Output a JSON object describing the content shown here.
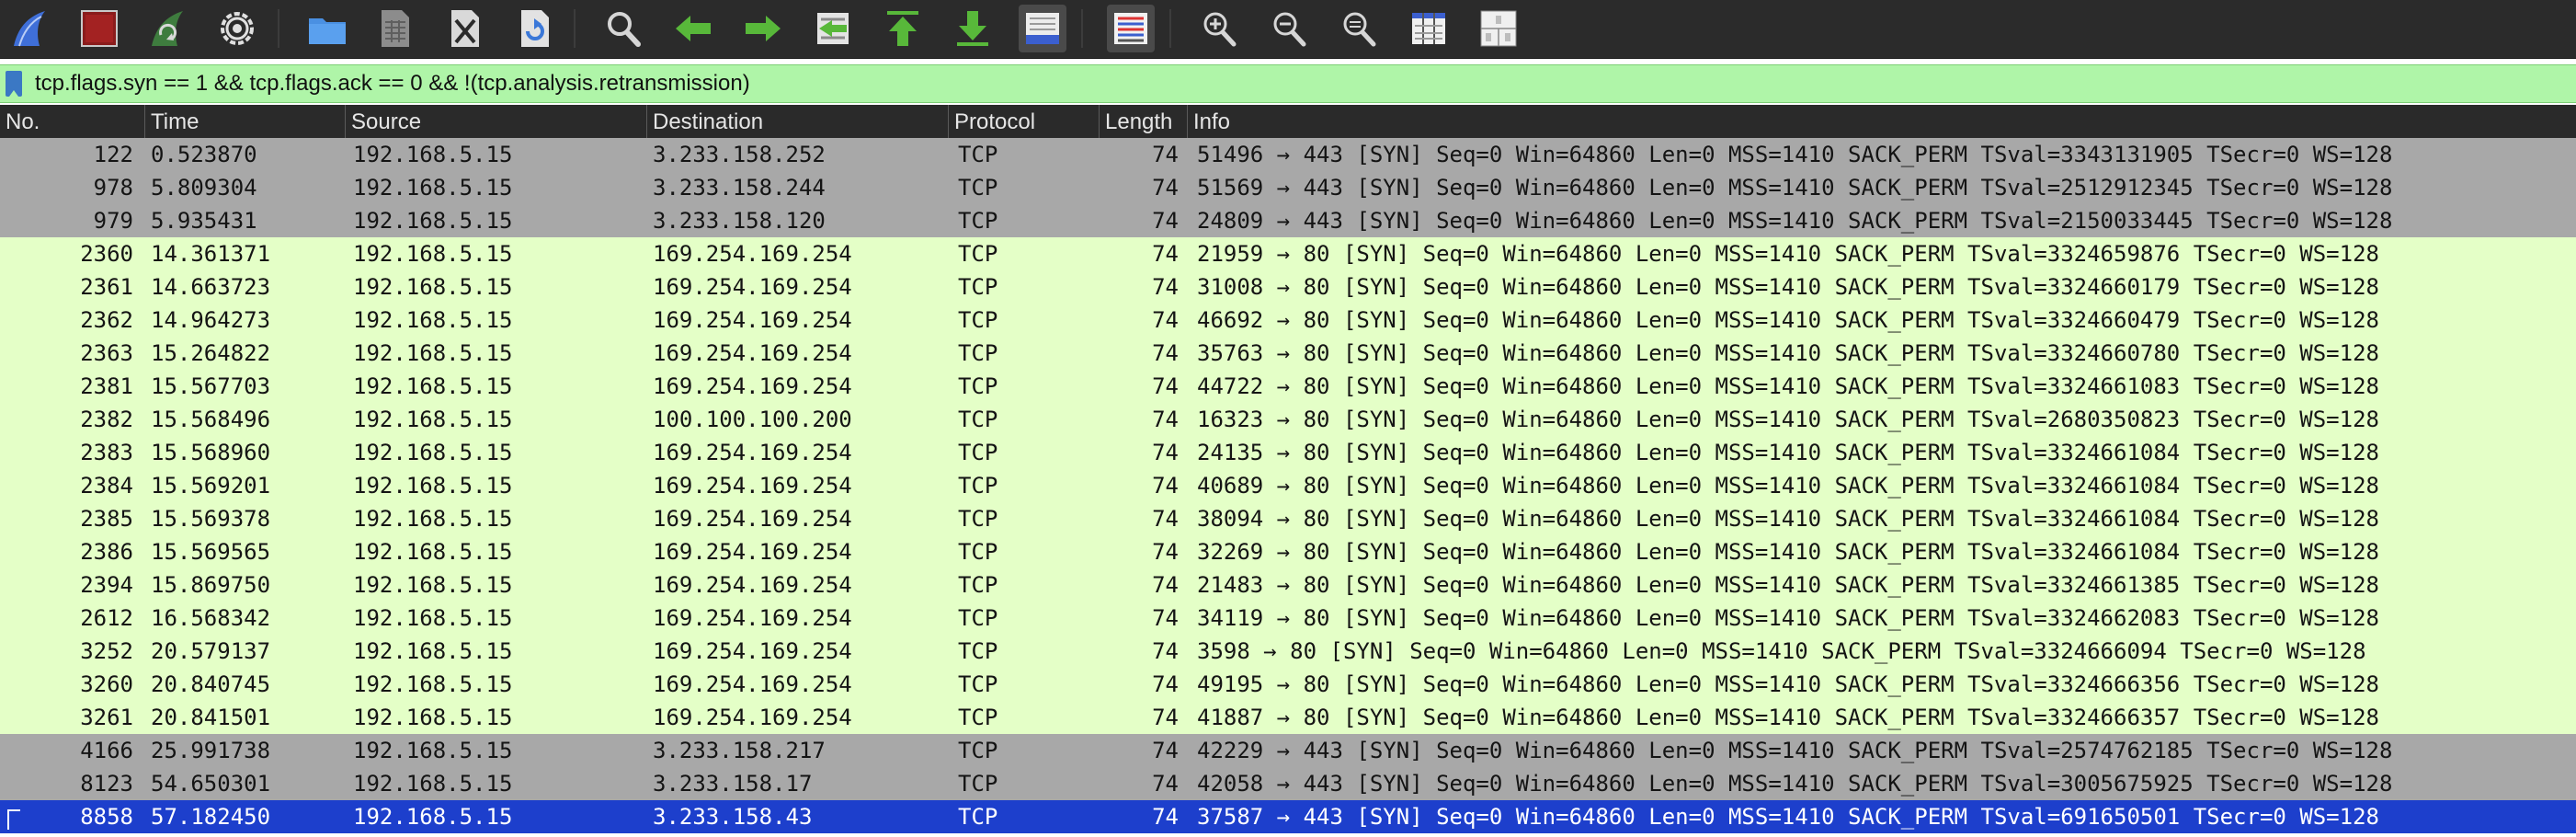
{
  "colors": {
    "toolbar_bg": "#2b2b2b",
    "filter_bg": "#aff5a8",
    "header_bg": "#2a2a2a",
    "row_gray": "#a8a8a8",
    "row_green": "#e4ffc7",
    "row_selected": "#1d3fcc"
  },
  "toolbar": {
    "buttons": [
      {
        "name": "start-capture",
        "icon": "shark-fin-icon"
      },
      {
        "name": "stop-capture",
        "icon": "stop-square-icon"
      },
      {
        "name": "restart-capture",
        "icon": "restart-fin-icon"
      },
      {
        "name": "capture-options",
        "icon": "gear-icon"
      },
      {
        "name": "open-file",
        "icon": "folder-icon"
      },
      {
        "name": "save-file",
        "icon": "file-grid-icon"
      },
      {
        "name": "close-file",
        "icon": "file-close-icon"
      },
      {
        "name": "reload-file",
        "icon": "file-reload-icon"
      },
      {
        "name": "find-packet",
        "icon": "magnifier-icon"
      },
      {
        "name": "go-back",
        "icon": "arrow-left-icon"
      },
      {
        "name": "go-forward",
        "icon": "arrow-right-icon"
      },
      {
        "name": "go-to-packet",
        "icon": "jump-packet-icon"
      },
      {
        "name": "first-packet",
        "icon": "arrow-up-bar-icon"
      },
      {
        "name": "last-packet",
        "icon": "arrow-down-bar-icon"
      },
      {
        "name": "auto-scroll",
        "icon": "autoscroll-icon"
      },
      {
        "name": "colorize",
        "icon": "colorize-lines-icon"
      },
      {
        "name": "zoom-in",
        "icon": "zoom-in-icon"
      },
      {
        "name": "zoom-out",
        "icon": "zoom-out-icon"
      },
      {
        "name": "normal-size",
        "icon": "zoom-reset-icon"
      },
      {
        "name": "resize-columns",
        "icon": "resize-columns-icon"
      },
      {
        "name": "layout",
        "icon": "layout-grid-icon"
      }
    ]
  },
  "filter": {
    "value": "tcp.flags.syn == 1 && tcp.flags.ack == 0 && !(tcp.analysis.retransmission)"
  },
  "table": {
    "columns": [
      "No.",
      "Time",
      "Source",
      "Destination",
      "Protocol",
      "Length",
      "Info"
    ],
    "rows": [
      {
        "style": "gray",
        "no": "122",
        "time": "0.523870",
        "src": "192.168.5.15",
        "dst": "3.233.158.252",
        "proto": "TCP",
        "len": "74",
        "info": "51496 → 443 [SYN] Seq=0 Win=64860 Len=0 MSS=1410 SACK_PERM TSval=3343131905 TSecr=0 WS=128"
      },
      {
        "style": "gray",
        "no": "978",
        "time": "5.809304",
        "src": "192.168.5.15",
        "dst": "3.233.158.244",
        "proto": "TCP",
        "len": "74",
        "info": "51569 → 443 [SYN] Seq=0 Win=64860 Len=0 MSS=1410 SACK_PERM TSval=2512912345 TSecr=0 WS=128"
      },
      {
        "style": "gray",
        "no": "979",
        "time": "5.935431",
        "src": "192.168.5.15",
        "dst": "3.233.158.120",
        "proto": "TCP",
        "len": "74",
        "info": "24809 → 443 [SYN] Seq=0 Win=64860 Len=0 MSS=1410 SACK_PERM TSval=2150033445 TSecr=0 WS=128"
      },
      {
        "style": "green",
        "no": "2360",
        "time": "14.361371",
        "src": "192.168.5.15",
        "dst": "169.254.169.254",
        "proto": "TCP",
        "len": "74",
        "info": "21959 → 80 [SYN] Seq=0 Win=64860 Len=0 MSS=1410 SACK_PERM TSval=3324659876 TSecr=0 WS=128"
      },
      {
        "style": "green",
        "no": "2361",
        "time": "14.663723",
        "src": "192.168.5.15",
        "dst": "169.254.169.254",
        "proto": "TCP",
        "len": "74",
        "info": "31008 → 80 [SYN] Seq=0 Win=64860 Len=0 MSS=1410 SACK_PERM TSval=3324660179 TSecr=0 WS=128"
      },
      {
        "style": "green",
        "no": "2362",
        "time": "14.964273",
        "src": "192.168.5.15",
        "dst": "169.254.169.254",
        "proto": "TCP",
        "len": "74",
        "info": "46692 → 80 [SYN] Seq=0 Win=64860 Len=0 MSS=1410 SACK_PERM TSval=3324660479 TSecr=0 WS=128"
      },
      {
        "style": "green",
        "no": "2363",
        "time": "15.264822",
        "src": "192.168.5.15",
        "dst": "169.254.169.254",
        "proto": "TCP",
        "len": "74",
        "info": "35763 → 80 [SYN] Seq=0 Win=64860 Len=0 MSS=1410 SACK_PERM TSval=3324660780 TSecr=0 WS=128"
      },
      {
        "style": "green",
        "no": "2381",
        "time": "15.567703",
        "src": "192.168.5.15",
        "dst": "169.254.169.254",
        "proto": "TCP",
        "len": "74",
        "info": "44722 → 80 [SYN] Seq=0 Win=64860 Len=0 MSS=1410 SACK_PERM TSval=3324661083 TSecr=0 WS=128"
      },
      {
        "style": "green",
        "no": "2382",
        "time": "15.568496",
        "src": "192.168.5.15",
        "dst": "100.100.100.200",
        "proto": "TCP",
        "len": "74",
        "info": "16323 → 80 [SYN] Seq=0 Win=64860 Len=0 MSS=1410 SACK_PERM TSval=2680350823 TSecr=0 WS=128"
      },
      {
        "style": "green",
        "no": "2383",
        "time": "15.568960",
        "src": "192.168.5.15",
        "dst": "169.254.169.254",
        "proto": "TCP",
        "len": "74",
        "info": "24135 → 80 [SYN] Seq=0 Win=64860 Len=0 MSS=1410 SACK_PERM TSval=3324661084 TSecr=0 WS=128"
      },
      {
        "style": "green",
        "no": "2384",
        "time": "15.569201",
        "src": "192.168.5.15",
        "dst": "169.254.169.254",
        "proto": "TCP",
        "len": "74",
        "info": "40689 → 80 [SYN] Seq=0 Win=64860 Len=0 MSS=1410 SACK_PERM TSval=3324661084 TSecr=0 WS=128"
      },
      {
        "style": "green",
        "no": "2385",
        "time": "15.569378",
        "src": "192.168.5.15",
        "dst": "169.254.169.254",
        "proto": "TCP",
        "len": "74",
        "info": "38094 → 80 [SYN] Seq=0 Win=64860 Len=0 MSS=1410 SACK_PERM TSval=3324661084 TSecr=0 WS=128"
      },
      {
        "style": "green",
        "no": "2386",
        "time": "15.569565",
        "src": "192.168.5.15",
        "dst": "169.254.169.254",
        "proto": "TCP",
        "len": "74",
        "info": "32269 → 80 [SYN] Seq=0 Win=64860 Len=0 MSS=1410 SACK_PERM TSval=3324661084 TSecr=0 WS=128"
      },
      {
        "style": "green",
        "no": "2394",
        "time": "15.869750",
        "src": "192.168.5.15",
        "dst": "169.254.169.254",
        "proto": "TCP",
        "len": "74",
        "info": "21483 → 80 [SYN] Seq=0 Win=64860 Len=0 MSS=1410 SACK_PERM TSval=3324661385 TSecr=0 WS=128"
      },
      {
        "style": "green",
        "no": "2612",
        "time": "16.568342",
        "src": "192.168.5.15",
        "dst": "169.254.169.254",
        "proto": "TCP",
        "len": "74",
        "info": "34119 → 80 [SYN] Seq=0 Win=64860 Len=0 MSS=1410 SACK_PERM TSval=3324662083 TSecr=0 WS=128"
      },
      {
        "style": "green",
        "no": "3252",
        "time": "20.579137",
        "src": "192.168.5.15",
        "dst": "169.254.169.254",
        "proto": "TCP",
        "len": "74",
        "info": "3598 → 80 [SYN] Seq=0 Win=64860 Len=0 MSS=1410 SACK_PERM TSval=3324666094 TSecr=0 WS=128"
      },
      {
        "style": "green",
        "no": "3260",
        "time": "20.840745",
        "src": "192.168.5.15",
        "dst": "169.254.169.254",
        "proto": "TCP",
        "len": "74",
        "info": "49195 → 80 [SYN] Seq=0 Win=64860 Len=0 MSS=1410 SACK_PERM TSval=3324666356 TSecr=0 WS=128"
      },
      {
        "style": "green",
        "no": "3261",
        "time": "20.841501",
        "src": "192.168.5.15",
        "dst": "169.254.169.254",
        "proto": "TCP",
        "len": "74",
        "info": "41887 → 80 [SYN] Seq=0 Win=64860 Len=0 MSS=1410 SACK_PERM TSval=3324666357 TSecr=0 WS=128"
      },
      {
        "style": "gray",
        "no": "4166",
        "time": "25.991738",
        "src": "192.168.5.15",
        "dst": "3.233.158.217",
        "proto": "TCP",
        "len": "74",
        "info": "42229 → 443 [SYN] Seq=0 Win=64860 Len=0 MSS=1410 SACK_PERM TSval=2574762185 TSecr=0 WS=128"
      },
      {
        "style": "gray",
        "no": "8123",
        "time": "54.650301",
        "src": "192.168.5.15",
        "dst": "3.233.158.17",
        "proto": "TCP",
        "len": "74",
        "info": "42058 → 443 [SYN] Seq=0 Win=64860 Len=0 MSS=1410 SACK_PERM TSval=3005675925 TSecr=0 WS=128"
      },
      {
        "style": "selected",
        "no": "8858",
        "time": "57.182450",
        "src": "192.168.5.15",
        "dst": "3.233.158.43",
        "proto": "TCP",
        "len": "74",
        "info": "37587 → 443 [SYN] Seq=0 Win=64860 Len=0 MSS=1410 SACK_PERM TSval=691650501 TSecr=0 WS=128"
      }
    ]
  }
}
